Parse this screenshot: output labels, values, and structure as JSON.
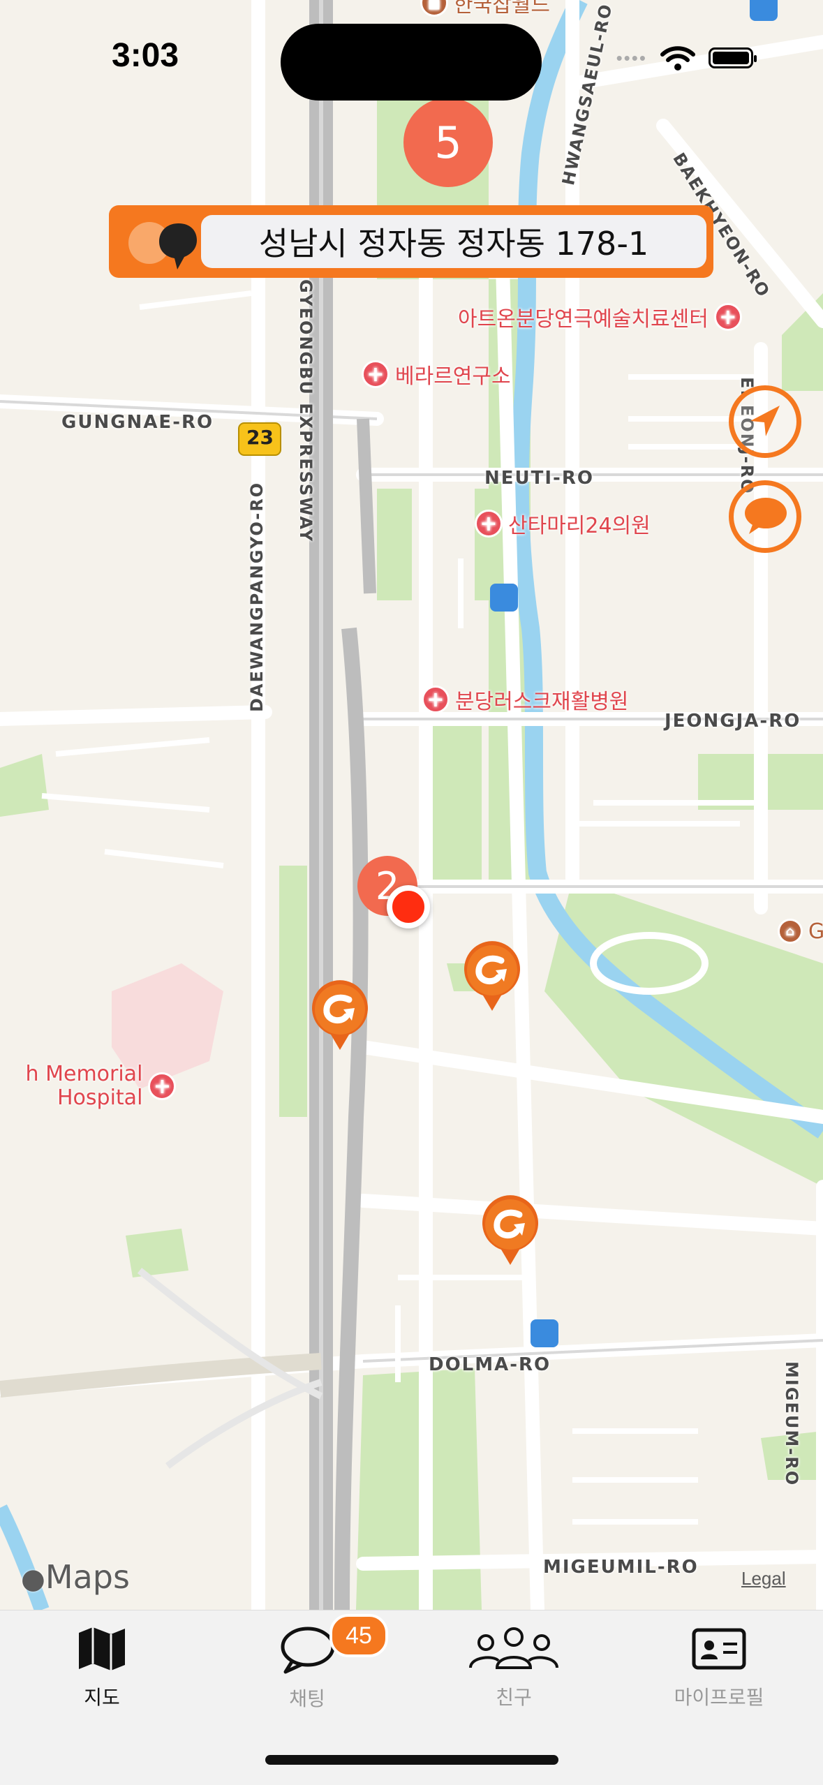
{
  "status_bar": {
    "time": "3:03"
  },
  "map": {
    "cluster_top": "5",
    "cluster_small": "2",
    "roads": {
      "gungnae": "GUNGNAE-RO",
      "neuti": "NEUTI-RO",
      "jeongja": "JEONGJA-RO",
      "dolma": "DOLMA-RO",
      "migeumil": "MIGEUMIL-RO",
      "hwangsaeul": "HWANGSAEUL-RO",
      "baekhyeon": "BAEKHYEON-RO",
      "daewangpangyo": "DAEWANGPANGYO-RO",
      "gyeongbu": "GYEONGBU EXPRESSWAY",
      "gyeongbu_top": "GYEONGBU EXPRESSWAY",
      "migeum": "MIGEUM-RO",
      "eastside": "E.  EONJ-RO",
      "route23": "23"
    },
    "pois": {
      "p1": "아트온분당연극예술치료센터",
      "p2": "베라르연구소",
      "p3": "산타마리24의원",
      "p4": "분당러스크재활병원",
      "p5": "h Memorial",
      "p5b": "Hospital",
      "p6": "한국잡월드",
      "p7": "G"
    },
    "attribution": "Maps",
    "legal": "Legal"
  },
  "address_bar": {
    "text": "성남시 정자동 정자동 178-1"
  },
  "tabbar": {
    "tabs": [
      {
        "label": "지도",
        "icon": "map-icon",
        "active": true
      },
      {
        "label": "채팅",
        "icon": "chat-bubble-icon",
        "active": false
      },
      {
        "label": "친구",
        "icon": "friends-icon",
        "active": false
      },
      {
        "label": "마이프로필",
        "icon": "profile-card-icon",
        "active": false
      }
    ],
    "chat_badge": "45"
  },
  "colors": {
    "accent": "#f5781f",
    "cluster": "#f26a4f",
    "location": "#ff2d10"
  }
}
